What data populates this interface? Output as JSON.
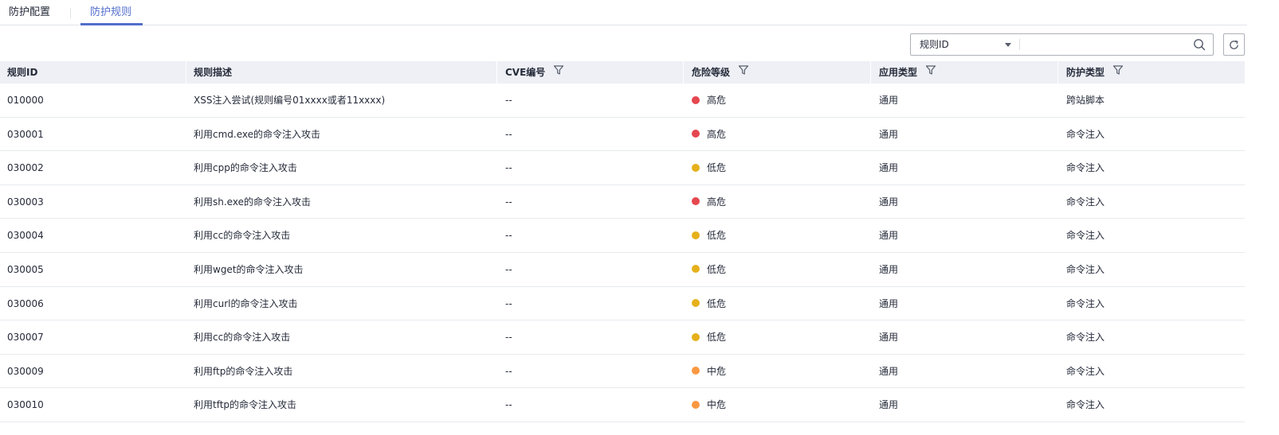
{
  "tabs": [
    {
      "label": "防护配置",
      "active": false
    },
    {
      "label": "防护规则",
      "active": true
    }
  ],
  "toolbar": {
    "search_field_selected": "规则ID",
    "search_value": "",
    "search_icon": "search-icon",
    "refresh_icon": "refresh-icon"
  },
  "colors": {
    "accent": "#526ecc",
    "high": "#e5474f",
    "medium": "#fa9841",
    "low": "#e6b01b"
  },
  "table": {
    "columns": [
      {
        "label": "规则ID",
        "filter": false
      },
      {
        "label": "规则描述",
        "filter": false
      },
      {
        "label": "CVE编号",
        "filter": true
      },
      {
        "label": "危险等级",
        "filter": true
      },
      {
        "label": "应用类型",
        "filter": true
      },
      {
        "label": "防护类型",
        "filter": true
      }
    ],
    "rows": [
      {
        "id": "010000",
        "desc": "XSS注入尝试(规则编号01xxxx或者11xxxx)",
        "cve": "--",
        "level": "高危",
        "level_key": "high",
        "app": "通用",
        "type": "跨站脚本"
      },
      {
        "id": "030001",
        "desc": "利用cmd.exe的命令注入攻击",
        "cve": "--",
        "level": "高危",
        "level_key": "high",
        "app": "通用",
        "type": "命令注入"
      },
      {
        "id": "030002",
        "desc": "利用cpp的命令注入攻击",
        "cve": "--",
        "level": "低危",
        "level_key": "low",
        "app": "通用",
        "type": "命令注入"
      },
      {
        "id": "030003",
        "desc": "利用sh.exe的命令注入攻击",
        "cve": "--",
        "level": "高危",
        "level_key": "high",
        "app": "通用",
        "type": "命令注入"
      },
      {
        "id": "030004",
        "desc": "利用cc的命令注入攻击",
        "cve": "--",
        "level": "低危",
        "level_key": "low",
        "app": "通用",
        "type": "命令注入"
      },
      {
        "id": "030005",
        "desc": "利用wget的命令注入攻击",
        "cve": "--",
        "level": "低危",
        "level_key": "low",
        "app": "通用",
        "type": "命令注入"
      },
      {
        "id": "030006",
        "desc": "利用curl的命令注入攻击",
        "cve": "--",
        "level": "低危",
        "level_key": "low",
        "app": "通用",
        "type": "命令注入"
      },
      {
        "id": "030007",
        "desc": "利用cc的命令注入攻击",
        "cve": "--",
        "level": "低危",
        "level_key": "low",
        "app": "通用",
        "type": "命令注入"
      },
      {
        "id": "030009",
        "desc": "利用ftp的命令注入攻击",
        "cve": "--",
        "level": "中危",
        "level_key": "medium",
        "app": "通用",
        "type": "命令注入"
      },
      {
        "id": "030010",
        "desc": "利用tftp的命令注入攻击",
        "cve": "--",
        "level": "中危",
        "level_key": "medium",
        "app": "通用",
        "type": "命令注入"
      }
    ]
  }
}
